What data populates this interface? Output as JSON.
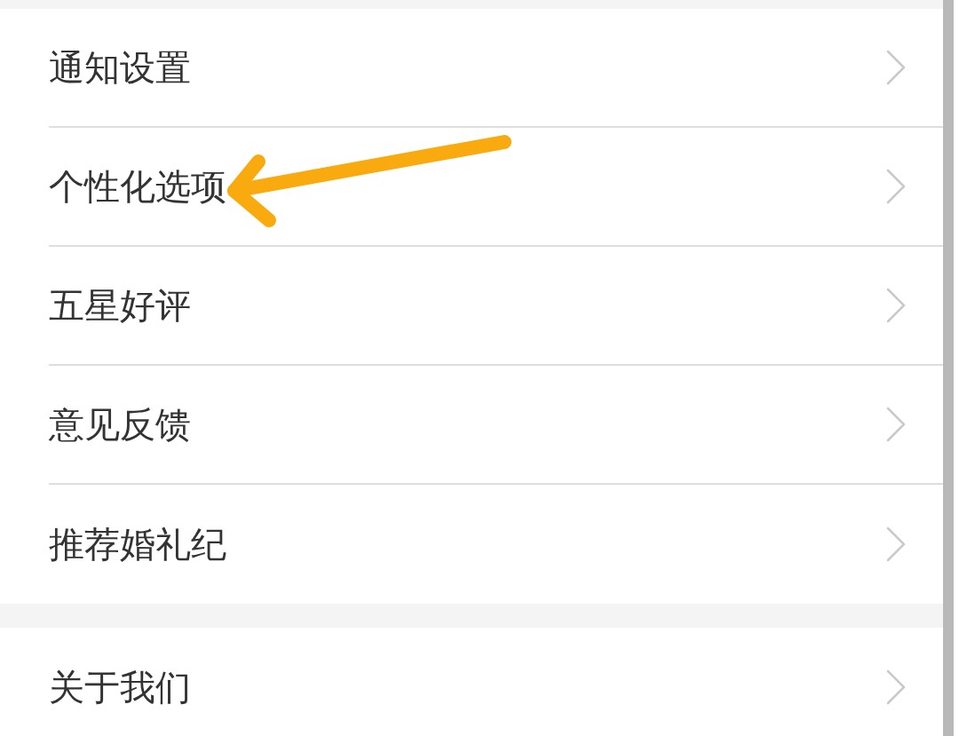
{
  "sections": [
    {
      "items": [
        {
          "label": "通知设置"
        },
        {
          "label": "个性化选项"
        },
        {
          "label": "五星好评"
        },
        {
          "label": "意见反馈"
        },
        {
          "label": "推荐婚礼纪"
        }
      ]
    },
    {
      "items": [
        {
          "label": "关于我们"
        }
      ]
    }
  ]
}
